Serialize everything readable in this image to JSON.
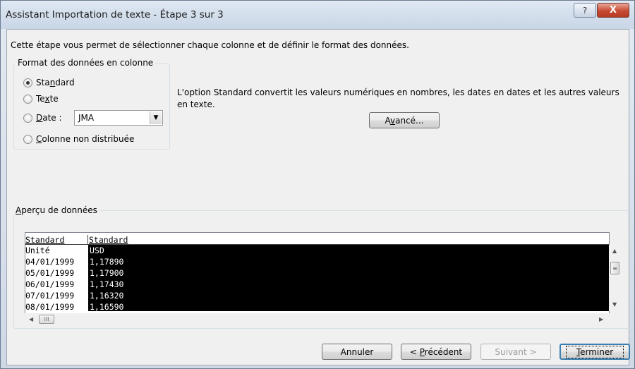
{
  "window": {
    "title": "Assistant Importation de texte - Étape 3 sur 3",
    "help_glyph": "?",
    "close_glyph": "X"
  },
  "intro": "Cette étape vous permet de sélectionner chaque colonne et de définir le format des données.",
  "format_group": {
    "legend": "Format des données en colonne",
    "options": [
      {
        "pre": "Sta",
        "acc": "n",
        "post": "dard",
        "checked": true
      },
      {
        "pre": "Te",
        "acc": "x",
        "post": "te",
        "checked": false
      },
      {
        "pre": "",
        "acc": "D",
        "post": "ate :",
        "checked": false
      },
      {
        "pre": "",
        "acc": "C",
        "post": "olonne non distribuée",
        "checked": false
      }
    ],
    "date_format_value": "JMA"
  },
  "description": "L'option Standard convertit les valeurs numériques en nombres, les dates en dates et les autres valeurs en texte.",
  "advanced_button": {
    "pre": "A",
    "acc": "v",
    "post": "ancé..."
  },
  "preview": {
    "legend_acc": "A",
    "legend_rest": "perçu de données",
    "headers": [
      "Standard",
      "Standard"
    ],
    "rows": [
      [
        "Unité",
        "USD"
      ],
      [
        "04/01/1999",
        "1,17890"
      ],
      [
        "05/01/1999",
        "1,17900"
      ],
      [
        "06/01/1999",
        "1,17430"
      ],
      [
        "07/01/1999",
        "1,16320"
      ],
      [
        "08/01/1999",
        "1,16590"
      ]
    ]
  },
  "buttons": {
    "cancel": "Annuler",
    "previous_pre": "< ",
    "previous_acc": "P",
    "previous_post": "récédent",
    "next": "Suivant >",
    "finish_acc": "T",
    "finish_post": "erminer"
  },
  "icons": {
    "radio": "radio-icon",
    "dropdown": "chevron-down-icon",
    "scroll_up": "arrow-up-icon",
    "scroll_down": "arrow-down-icon",
    "scroll_left": "arrow-left-icon",
    "scroll_right": "arrow-right-icon"
  },
  "colors": {
    "title_bar": "#d4dfec",
    "close_button": "#c74a33",
    "preview_selection": "#000000",
    "default_button_border": "#3c7fb1"
  }
}
